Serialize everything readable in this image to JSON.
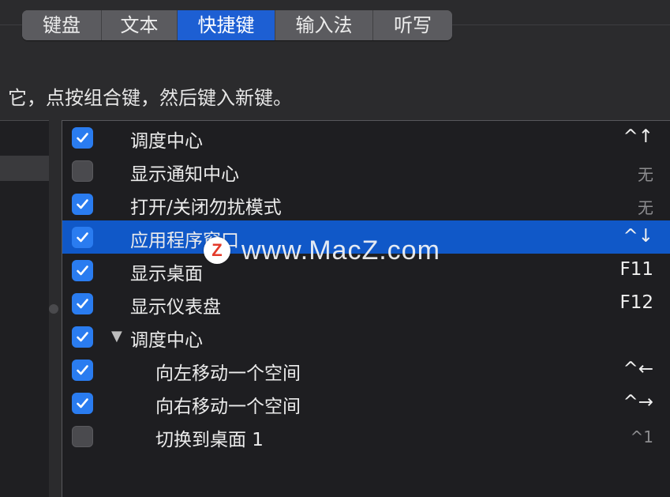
{
  "tabs": [
    {
      "label": "键盘",
      "active": false
    },
    {
      "label": "文本",
      "active": false
    },
    {
      "label": "快捷键",
      "active": true
    },
    {
      "label": "输入法",
      "active": false
    },
    {
      "label": "听写",
      "active": false
    }
  ],
  "hint": "它，点按组合键，然后键入新键。",
  "shortcuts": [
    {
      "label": "调度中心",
      "shortcut": "^↑",
      "checked": true,
      "indent": 0,
      "selected": false
    },
    {
      "label": "显示通知中心",
      "shortcut": "无",
      "checked": false,
      "indent": 0,
      "selected": false
    },
    {
      "label": "打开/关闭勿扰模式",
      "shortcut": "无",
      "checked": true,
      "indent": 0,
      "selected": false
    },
    {
      "label": "应用程序窗口",
      "shortcut": "^↓",
      "checked": true,
      "indent": 0,
      "selected": true
    },
    {
      "label": "显示桌面",
      "shortcut": "F11",
      "checked": true,
      "indent": 0,
      "selected": false
    },
    {
      "label": "显示仪表盘",
      "shortcut": "F12",
      "checked": true,
      "indent": 0,
      "selected": false
    },
    {
      "label": "调度中心",
      "shortcut": "",
      "checked": true,
      "indent": 0,
      "selected": false,
      "expanded": true
    },
    {
      "label": "向左移动一个空间",
      "shortcut": "^←",
      "checked": true,
      "indent": 1,
      "selected": false
    },
    {
      "label": "向右移动一个空间",
      "shortcut": "^→",
      "checked": true,
      "indent": 1,
      "selected": false
    },
    {
      "label": "切换到桌面 1",
      "shortcut": "^1",
      "checked": false,
      "indent": 1,
      "selected": false
    }
  ],
  "watermark": {
    "logo_letter": "Z",
    "text": "www.MacZ.com"
  },
  "colors": {
    "accent": "#1d5fd3",
    "selection": "#1058c8",
    "checkbox_on": "#2a7cf0"
  }
}
